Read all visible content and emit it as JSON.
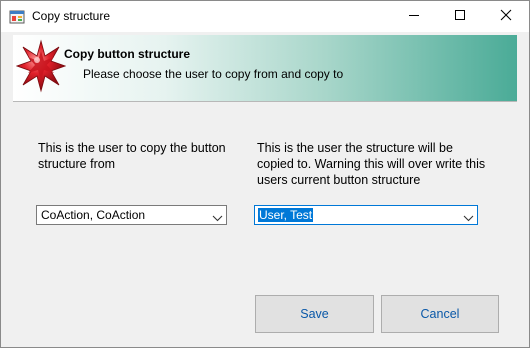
{
  "window": {
    "title": "Copy structure",
    "icons": {
      "app": "app-window-icon",
      "minimize": "minimize-icon",
      "maximize": "maximize-icon",
      "close": "close-icon"
    }
  },
  "header": {
    "title": "Copy button structure",
    "subtitle": "Please choose the user to copy from and copy to",
    "icon": "red-star-icon",
    "gradient_colors": [
      "#ffffff",
      "#4aab97"
    ]
  },
  "source": {
    "description": "This is the user to copy the button structure from",
    "selected": "CoAction, CoAction"
  },
  "target": {
    "description": "This is the user the structure will be copied to.  Warning this will over write this users current button structure",
    "selected": "User, Test"
  },
  "buttons": {
    "save": "Save",
    "cancel": "Cancel"
  },
  "colors": {
    "accent": "#0078d7",
    "button_text": "#0a58a8"
  }
}
